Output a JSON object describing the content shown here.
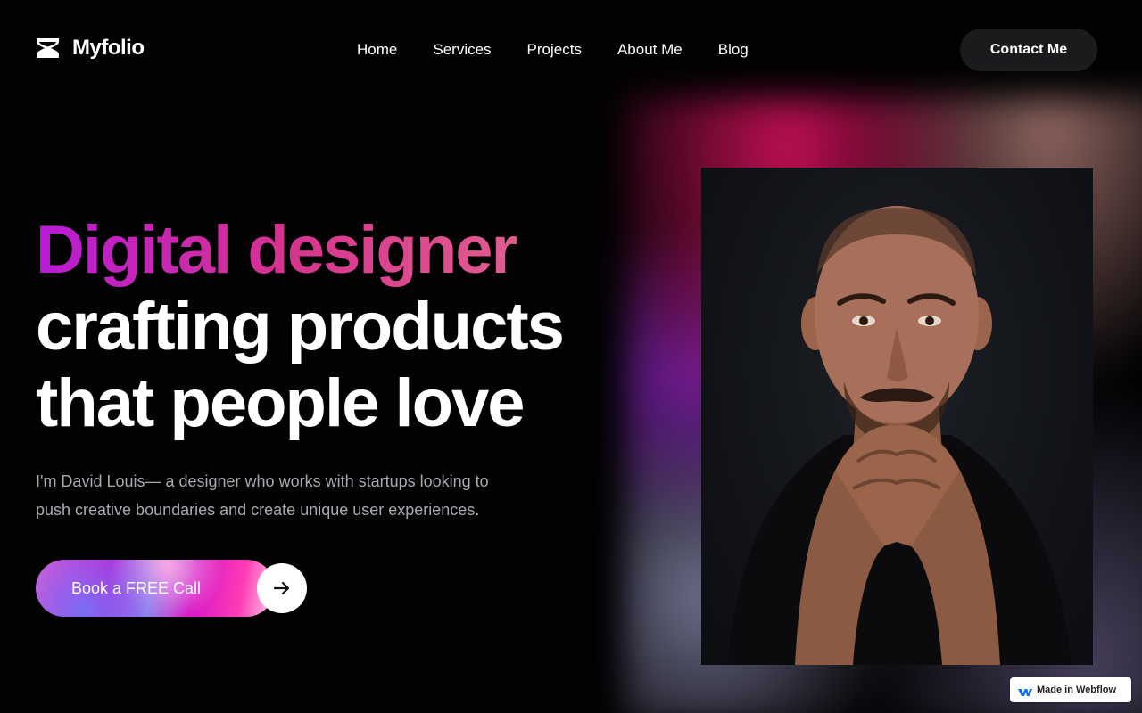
{
  "brand": {
    "name": "Myfolio",
    "logo_icon": "hourglass-logo-icon"
  },
  "nav": {
    "items": [
      {
        "label": "Home"
      },
      {
        "label": "Services"
      },
      {
        "label": "Projects"
      },
      {
        "label": "About Me"
      },
      {
        "label": "Blog"
      }
    ],
    "contact_label": "Contact Me"
  },
  "hero": {
    "headline_gradient": "Digital designer",
    "headline_line2": "crafting products",
    "headline_line3": "that people love",
    "intro": "I'm David Louis— a designer who works with startups looking to push creative boundaries and create unique user experiences.",
    "cta_label": "Book a FREE Call",
    "cta_icon": "arrow-right-icon",
    "portrait_alt": "Portrait of David Louis"
  },
  "badge": {
    "label": "Made in Webflow",
    "icon": "webflow-icon"
  },
  "colors": {
    "background": "#020203",
    "contact_button": "#1b1b1e",
    "gradient_start": "#b81bd6",
    "gradient_end": "#e36a8e",
    "intro_text": "#a9a9b0"
  }
}
